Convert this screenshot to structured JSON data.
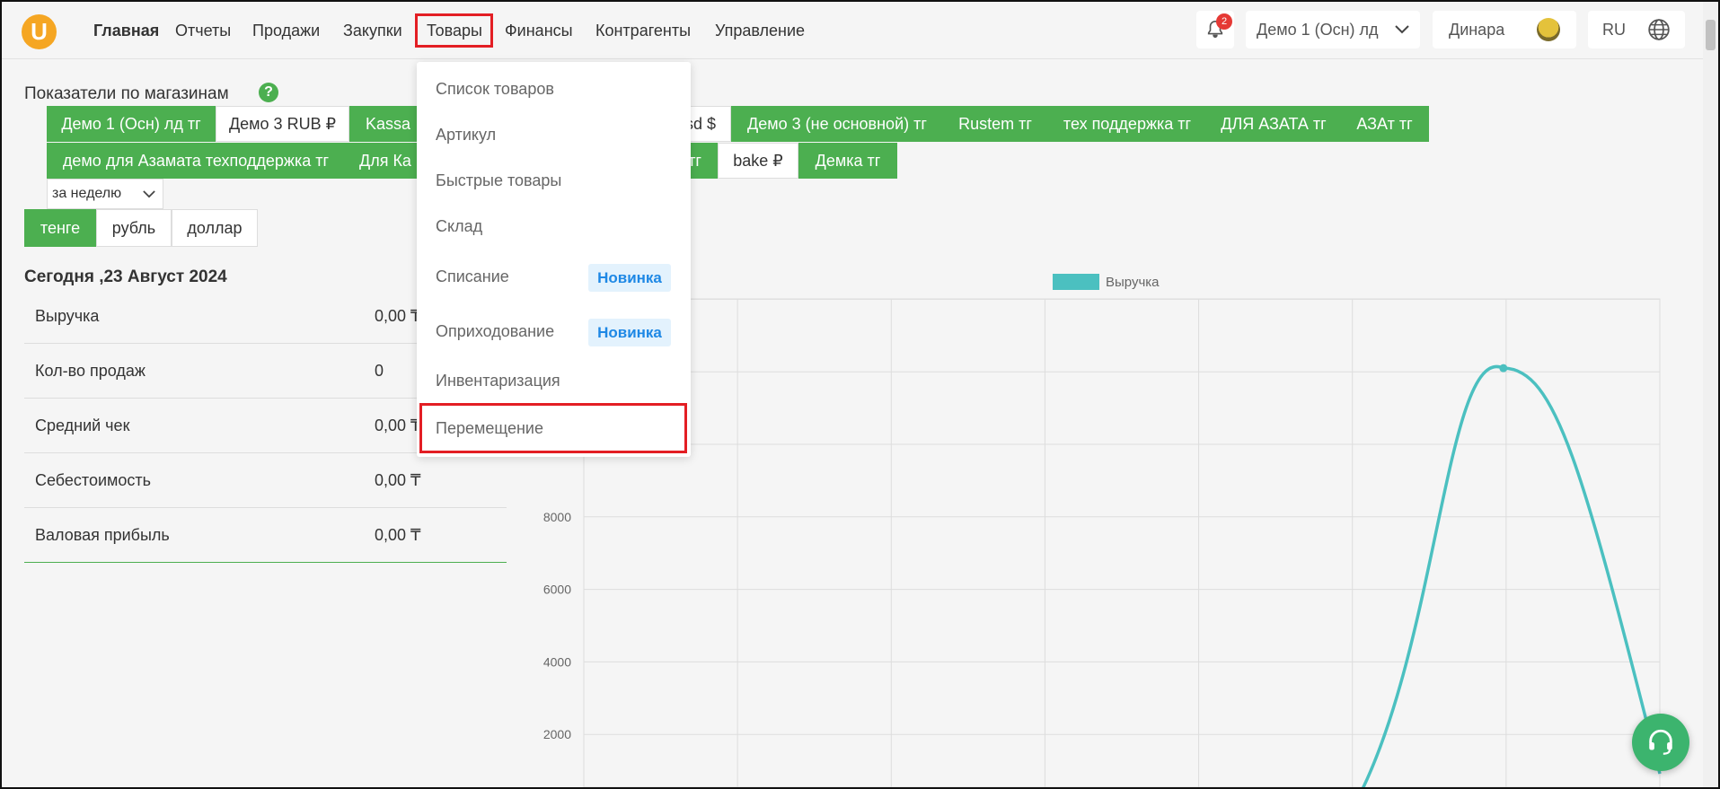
{
  "nav": {
    "items": [
      {
        "label": "Главная",
        "active": true
      },
      {
        "label": "Отчеты"
      },
      {
        "label": "Продажи"
      },
      {
        "label": "Закупки"
      },
      {
        "label": "Товары",
        "highlighted": true
      },
      {
        "label": "Финансы"
      },
      {
        "label": "Контрагенты"
      },
      {
        "label": "Управление"
      }
    ]
  },
  "header": {
    "logo_letter": "U",
    "notifications_count": "2",
    "store_name": "Демо 1 (Осн) лд",
    "user_name": "Динара",
    "language": "RU"
  },
  "left": {
    "title": "Показатели по магазинам",
    "help": "?",
    "stores_row1": [
      "Демо 1 (Осн) лд тг",
      "Демо 3 RUB ₽",
      "Kassa",
      "sd $",
      "Демо 3 (не основной) тг",
      "Rustem тг",
      "тех поддержка тг",
      "ДЛЯ АЗАТА тг",
      "АЗАт тг"
    ],
    "stores_row2": [
      "демо для Азамата техподдержка тг",
      "Для Ка",
      "тг",
      "bake ₽",
      "Демка тг"
    ],
    "period": "за неделю",
    "currencies": [
      "тенге",
      "рубль",
      "доллар"
    ],
    "today": "Сегодня ,23 Август 2024",
    "stats": [
      {
        "label": "Выручка",
        "value": "0,00 ₸"
      },
      {
        "label": "Кол-во продаж",
        "value": "0"
      },
      {
        "label": "Средний чек",
        "value": "0,00 ₸"
      },
      {
        "label": "Себестоимость",
        "value": "0,00 ₸"
      },
      {
        "label": "Валовая прибыль",
        "value": "0,00 ₸"
      }
    ]
  },
  "dropdown": {
    "items": [
      {
        "label": "Список товаров"
      },
      {
        "label": "Артикул"
      },
      {
        "label": "Быстрые товары"
      },
      {
        "label": "Склад"
      },
      {
        "label": "Списание",
        "badge": "Новинка"
      },
      {
        "label": "Оприходование",
        "badge": "Новинка"
      },
      {
        "label": "Инвентаризация"
      },
      {
        "label": "Перемещение",
        "highlighted": true
      }
    ]
  },
  "chart_data": {
    "type": "line",
    "series": [
      {
        "name": "Выручка",
        "color": "#4bc0c0"
      }
    ],
    "legend": "top-center",
    "yticks": [
      2000,
      4000,
      6000,
      8000
    ],
    "peak_value": 12100,
    "grid": true
  },
  "colors": {
    "accent": "#4caf50",
    "highlight": "#e31e24",
    "line": "#4bc0c0",
    "badge_bg": "#e3f2fd",
    "badge_text": "#1e88e5"
  }
}
